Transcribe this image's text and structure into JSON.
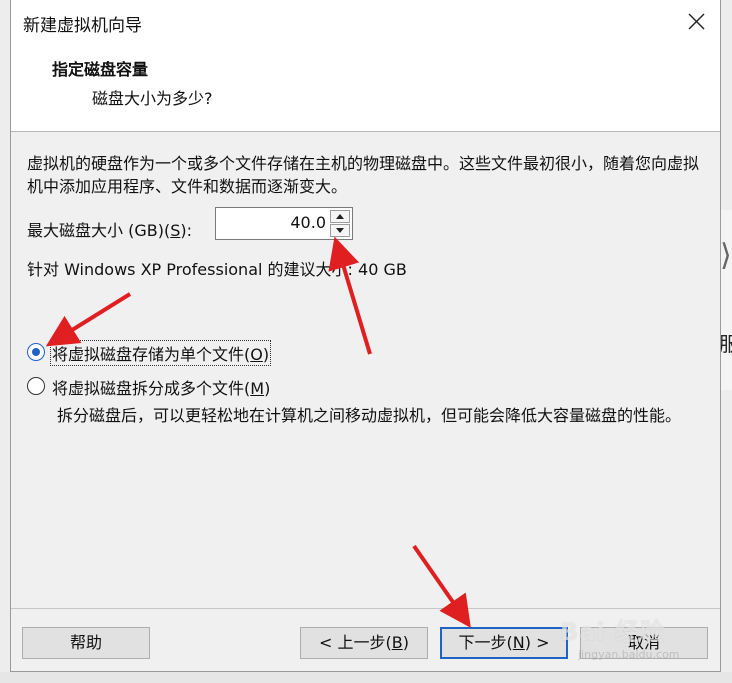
{
  "window": {
    "title": "新建虚拟机向导",
    "close_icon": "close-icon"
  },
  "header": {
    "title": "指定磁盘容量",
    "subtitle": "磁盘大小为多少?"
  },
  "content": {
    "description": "虚拟机的硬盘作为一个或多个文件存储在主机的物理磁盘中。这些文件最初很小，随着您向虚拟机中添加应用程序、文件和数据而逐渐变大。",
    "max_size_label_pre": "最大磁盘大小 (GB)(",
    "max_size_label_key": "S",
    "max_size_label_post": "):",
    "max_size_value": "40.0",
    "recommend_text": "针对 Windows XP Professional 的建议大小: 40 GB",
    "radio_single": {
      "label_pre": "将虚拟磁盘存储为单个文件(",
      "label_key": "O",
      "label_post": ")",
      "selected": true
    },
    "radio_split": {
      "label_pre": "将虚拟磁盘拆分成多个文件(",
      "label_key": "M",
      "label_post": ")",
      "selected": false
    },
    "split_description": "拆分磁盘后，可以更轻松地在计算机之间移动虚拟机，但可能会降低大容量磁盘的性能。"
  },
  "footer": {
    "help_label": "帮助",
    "back_pre": "< 上一步(",
    "back_key": "B",
    "back_post": ")",
    "next_pre": "下一步(",
    "next_key": "N",
    "next_post": ") >",
    "cancel_label": "取消"
  },
  "background": {
    "partial_text": "服"
  },
  "watermark": {
    "text": "Bai 经验",
    "sub": "jingyan.baidu.com"
  },
  "colors": {
    "accent": "#1e63c6",
    "annotation_arrow": "#e02020"
  }
}
